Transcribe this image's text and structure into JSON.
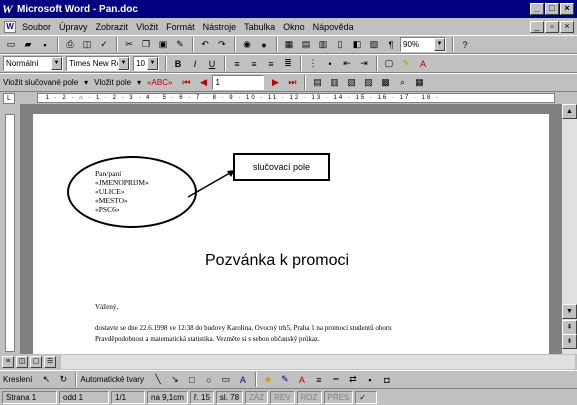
{
  "window": {
    "title": "Microsoft Word - Pan.doc"
  },
  "menu": [
    "Soubor",
    "Úpravy",
    "Zobrazit",
    "Vložit",
    "Formát",
    "Nástroje",
    "Tabulka",
    "Okno",
    "Nápověda"
  ],
  "std_toolbar": {
    "zoom": "90%"
  },
  "fmt_toolbar": {
    "style": "Normální",
    "font": "Times New Roman",
    "size": "10",
    "bold": "B",
    "italic": "I",
    "underline": "U"
  },
  "merge_toolbar": {
    "insert_merge_field": "Vložit slučované pole",
    "insert_word_field": "Vložit pole",
    "abc": "«ABC»",
    "record": "1"
  },
  "document": {
    "merge_lines": [
      "Pan/paní",
      "«JMENOPRIJM»",
      "«ULICE»",
      "«MESTO»",
      "«PSC6»"
    ],
    "callout": "slučovací pole",
    "heading": "Pozvánka k promoci",
    "salutation": "Vážený,",
    "body_lines": [
      "dostavte se dne 22.6.1998 ve 12:38 do budovy Karolina, Ovocný trh5, Praha 1 na promoci studentů oboru",
      "Pravděpodobnost a matematická statistika. Vezměte si s sebou občanský průkaz."
    ]
  },
  "drawing_toolbar": {
    "draw": "Kreslení",
    "autoshapes": "Automatické tvary"
  },
  "status": {
    "page": "Strana 1",
    "section": "odd 1",
    "pages": "1/1",
    "at": "na 9,1cm",
    "line": "ř. 15",
    "col": "sl. 78",
    "rec": "ZÁZ",
    "trk": "REV",
    "ext": "ROZ",
    "ovr": "PŘES"
  },
  "colors": {
    "title_bg": "#000080",
    "chrome": "#c0c0c0",
    "doc_bg": "#808080"
  }
}
